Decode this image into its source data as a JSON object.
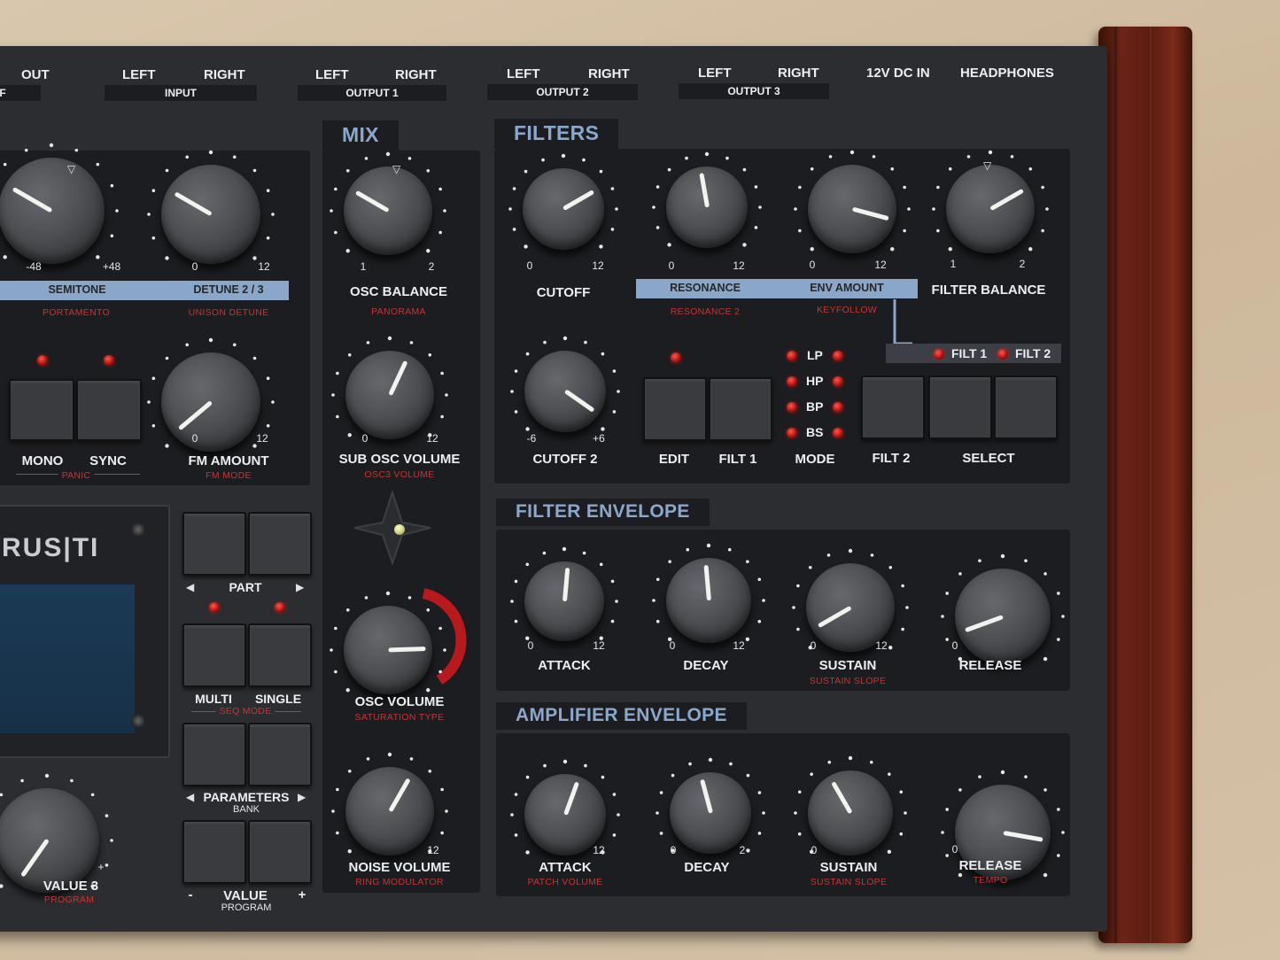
{
  "connectors": {
    "out": "OUT",
    "if_fragment": "IF",
    "input_left": "LEFT",
    "input_right": "RIGHT",
    "input_plate": "INPUT",
    "out1_left": "LEFT",
    "out1_right": "RIGHT",
    "out1_plate": "OUTPUT 1",
    "out2_left": "LEFT",
    "out2_right": "RIGHT",
    "out2_plate": "OUTPUT 2",
    "out3_left": "LEFT",
    "out3_right": "RIGHT",
    "out3_plate": "OUTPUT 3",
    "dc_in": "12V DC IN",
    "headphones": "HEADPHONES"
  },
  "osc": {
    "semitone_min": "-48",
    "semitone_max": "+48",
    "detune_min": "0",
    "detune_max": "12",
    "bar_semitone": "SEMITONE",
    "bar_detune": "DETUNE 2 / 3",
    "sub_portamento": "PORTAMENTO",
    "sub_unison": "UNISON DETUNE",
    "mono": "MONO",
    "sync": "SYNC",
    "panic": "PANIC",
    "fm_min": "0",
    "fm_max": "12",
    "fm_amount": "FM AMOUNT",
    "fm_mode": "FM MODE"
  },
  "mix": {
    "title": "MIX",
    "bal_min": "1",
    "bal_max": "2",
    "osc_balance": "OSC  BALANCE",
    "panorama": "PANORAMA",
    "sub_min": "0",
    "sub_max": "12",
    "sub_osc_volume": "SUB OSC VOLUME",
    "osc3_volume": "OSC3 VOLUME",
    "osc_volume": "OSC VOLUME",
    "saturation_type": "SATURATION TYPE",
    "noise_max": "12",
    "noise_volume": "NOISE VOLUME",
    "ring_modulator": "RING MODULATOR"
  },
  "filters": {
    "title": "FILTERS",
    "cutoff_min": "0",
    "cutoff_max": "12",
    "cutoff": "CUTOFF",
    "res_min": "0",
    "res_max": "12",
    "env_min": "0",
    "env_max": "12",
    "bal_min": "1",
    "bal_max": "2",
    "filter_balance": "FILTER BALANCE",
    "bar_resonance": "RESONANCE",
    "bar_env_amount": "ENV AMOUNT",
    "resonance_2": "RESONANCE 2",
    "keyfollow": "KEYFOLLOW",
    "filt1_led": "FILT 1",
    "filt2_led": "FILT 2",
    "cutoff2_min": "-6",
    "cutoff2_max": "+6",
    "cutoff_2": "CUTOFF 2",
    "modes": [
      "LP",
      "HP",
      "BP",
      "BS"
    ],
    "edit": "EDIT",
    "filt1": "FILT 1",
    "mode": "MODE",
    "filt2": "FILT 2",
    "select": "SELECT"
  },
  "filter_env": {
    "title": "FILTER ENVELOPE",
    "attack": "ATTACK",
    "decay": "DECAY",
    "sustain": "SUSTAIN",
    "release": "RELEASE",
    "sustain_slope": "SUSTAIN SLOPE",
    "min": "0",
    "max": "12"
  },
  "amp_env": {
    "title": "AMPLIFIER ENVELOPE",
    "attack": "ATTACK",
    "decay": "DECAY",
    "sustain": "SUSTAIN",
    "release": "RELEASE",
    "patch_volume": "PATCH VOLUME",
    "sustain_slope": "SUSTAIN SLOPE",
    "tempo": "TEMPO",
    "min": "0",
    "max": "12",
    "decay_max": "2"
  },
  "display": {
    "logo": "RUS|TI",
    "part": "PART",
    "multi": "MULTI",
    "single": "SINGLE",
    "seq_mode": "SEQ MODE",
    "parameters": "PARAMETERS",
    "bank": "BANK",
    "value": "VALUE",
    "program": "PROGRAM",
    "minus": "-",
    "plus": "+",
    "value3": "VALUE 3",
    "value3_sub": "PROGRAM",
    "value3_plus": "+"
  }
}
